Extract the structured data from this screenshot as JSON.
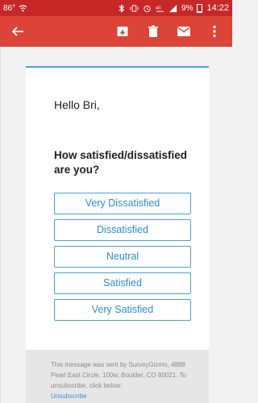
{
  "status": {
    "temperature": "86°",
    "battery_pct": "9%",
    "time": "14:22"
  },
  "toolbar": {
    "back_icon": "arrow-left-icon",
    "archive_icon": "archive-icon",
    "delete_icon": "trash-icon",
    "mail_icon": "mail-icon",
    "more_icon": "more-vert-icon"
  },
  "email": {
    "greeting": "Hello Bri,",
    "question": "How satisfied/dissatisfied are you?",
    "choices": [
      "Very Dissatisfied",
      "Dissatisfied",
      "Neutral",
      "Satisfied",
      "Very Satisfied"
    ],
    "footer_text": "This message was sent by SurveyGizmo, 4888 Pearl East Circle, 100w, Boulder, CO 80021. To unsubscribe, click below:",
    "unsubscribe_label": "Unsubscribe"
  },
  "colors": {
    "status_bar": "#c62828",
    "app_bar": "#db4437",
    "accent": "#4aa3d8"
  }
}
